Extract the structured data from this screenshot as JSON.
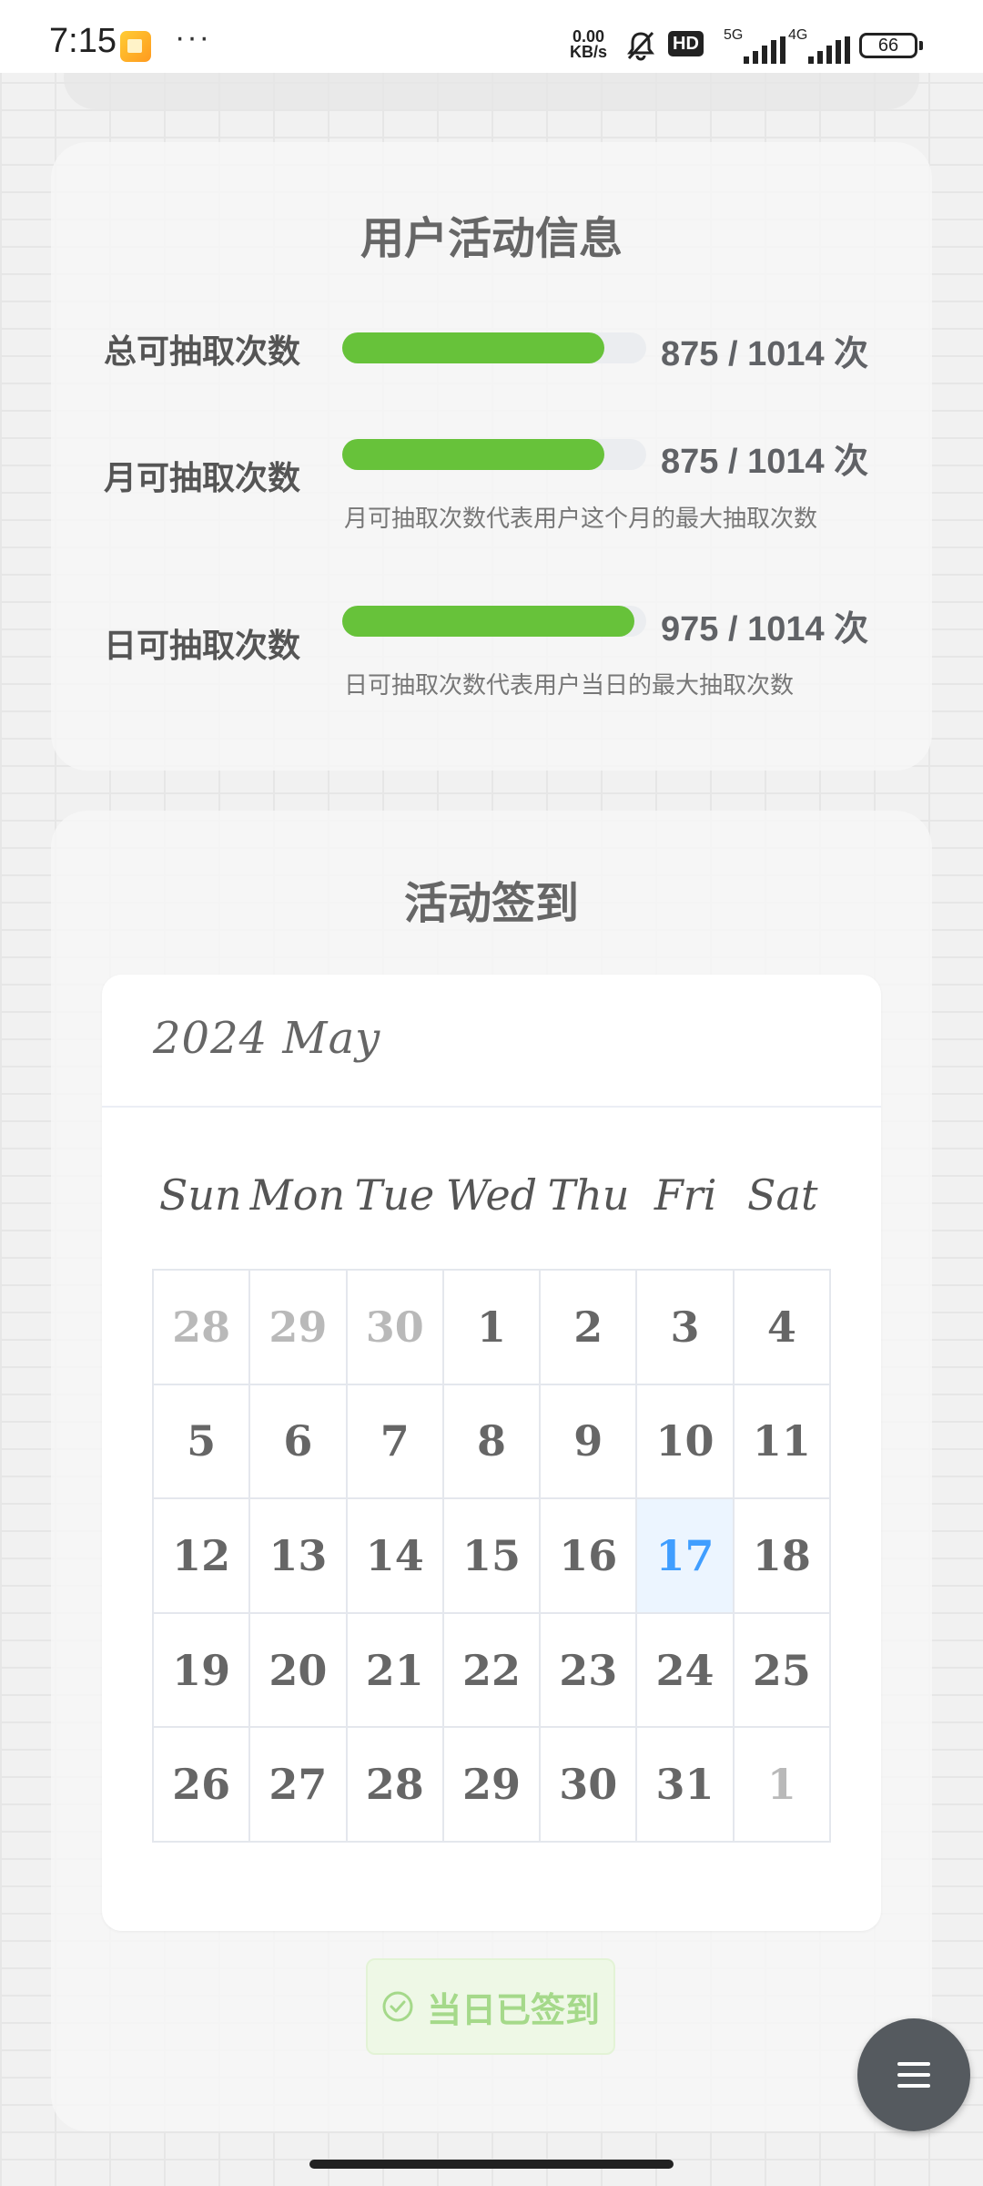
{
  "status_bar": {
    "time": "7:15",
    "dots": "···",
    "net_speed_value": "0.00",
    "net_speed_unit": "KB/s",
    "hd_badge": "HD",
    "signal1_label": "5G",
    "signal2_label": "4G",
    "battery": "66"
  },
  "activity_info": {
    "title": "用户活动信息",
    "rows": [
      {
        "label": "总可抽取次数",
        "count": "875 / 1014 次",
        "progress": 0.863,
        "note": ""
      },
      {
        "label": "月可抽取次数",
        "count": "875 / 1014 次",
        "progress": 0.863,
        "note": "月可抽取次数代表用户这个月的最大抽取次数"
      },
      {
        "label": "日可抽取次数",
        "count": "975 / 1014 次",
        "progress": 0.962,
        "note": "日可抽取次数代表用户当日的最大抽取次数"
      }
    ]
  },
  "sign_in": {
    "title": "活动签到",
    "calendar": {
      "title": "2024 May",
      "weekdays": [
        "Sun",
        "Mon",
        "Tue",
        "Wed",
        "Thu",
        "Fri",
        "Sat"
      ],
      "weeks": [
        [
          {
            "d": "28",
            "other": true
          },
          {
            "d": "29",
            "other": true
          },
          {
            "d": "30",
            "other": true
          },
          {
            "d": "1"
          },
          {
            "d": "2"
          },
          {
            "d": "3"
          },
          {
            "d": "4"
          }
        ],
        [
          {
            "d": "5"
          },
          {
            "d": "6"
          },
          {
            "d": "7"
          },
          {
            "d": "8"
          },
          {
            "d": "9"
          },
          {
            "d": "10"
          },
          {
            "d": "11"
          }
        ],
        [
          {
            "d": "12"
          },
          {
            "d": "13"
          },
          {
            "d": "14"
          },
          {
            "d": "15"
          },
          {
            "d": "16"
          },
          {
            "d": "17",
            "today": true
          },
          {
            "d": "18"
          }
        ],
        [
          {
            "d": "19"
          },
          {
            "d": "20"
          },
          {
            "d": "21"
          },
          {
            "d": "22"
          },
          {
            "d": "23"
          },
          {
            "d": "24"
          },
          {
            "d": "25"
          }
        ],
        [
          {
            "d": "26"
          },
          {
            "d": "27"
          },
          {
            "d": "28"
          },
          {
            "d": "29"
          },
          {
            "d": "30"
          },
          {
            "d": "31"
          },
          {
            "d": "1",
            "other": true
          }
        ]
      ]
    },
    "button_label": "当日已签到",
    "button_icon": "check-circle-icon"
  },
  "fab_icon": "menu-icon",
  "colors": {
    "progress": "#67c23a",
    "today_bg": "#ecf5ff",
    "today_text": "#409eff",
    "button_text": "#a5d98a"
  }
}
